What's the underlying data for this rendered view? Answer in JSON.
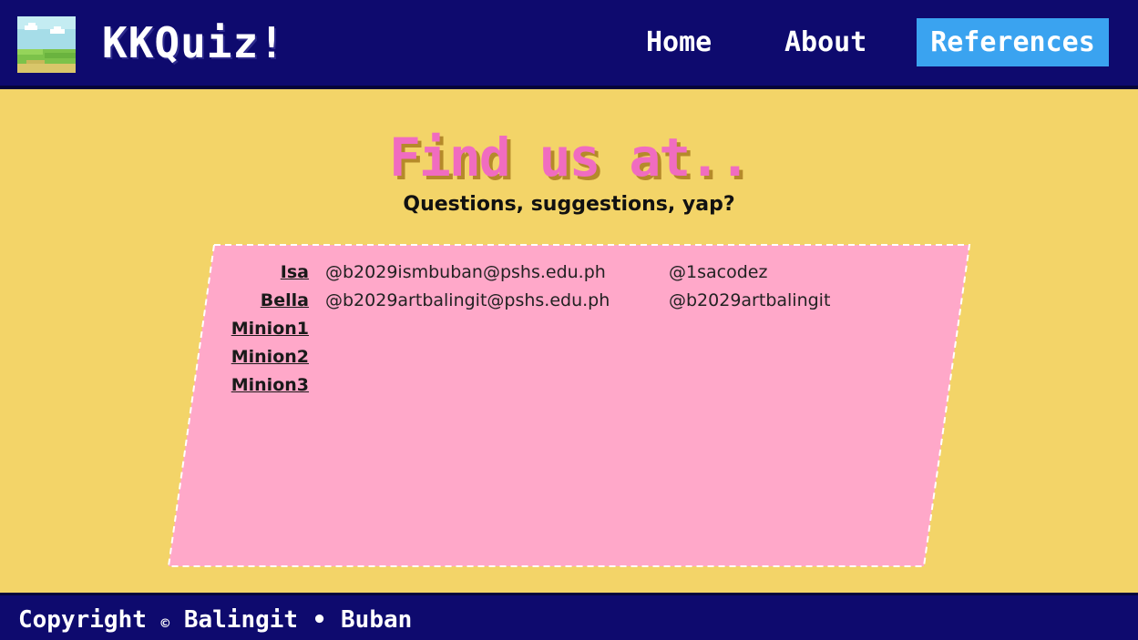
{
  "header": {
    "logo_alt": "landscape-logo",
    "app_title": "KKQuiz!",
    "nav": {
      "home": "Home",
      "about": "About",
      "references": "References"
    }
  },
  "main": {
    "title": "Find us at..",
    "subtitle": "Questions, suggestions, yap?",
    "contacts": [
      {
        "name": "Isa",
        "email": "@b2029ismbuban@pshs.edu.ph",
        "handle": "@1sacodez"
      },
      {
        "name": "Bella",
        "email": "@b2029artbalingit@pshs.edu.ph",
        "handle": "@b2029artbalingit"
      },
      {
        "name": "Minion1",
        "email": "",
        "handle": ""
      },
      {
        "name": "Minion2",
        "email": "",
        "handle": ""
      },
      {
        "name": "Minion3",
        "email": "",
        "handle": ""
      }
    ]
  },
  "footer": {
    "copyright_word": "Copyright",
    "copyright_symbol": "©",
    "authors": "Balingit • Buban"
  },
  "colors": {
    "header_bg": "#0e0a6e",
    "page_bg": "#f3d468",
    "card_bg": "#ffa8c9",
    "active_nav": "#3aa3f0",
    "title_pink": "#f06cc0"
  }
}
